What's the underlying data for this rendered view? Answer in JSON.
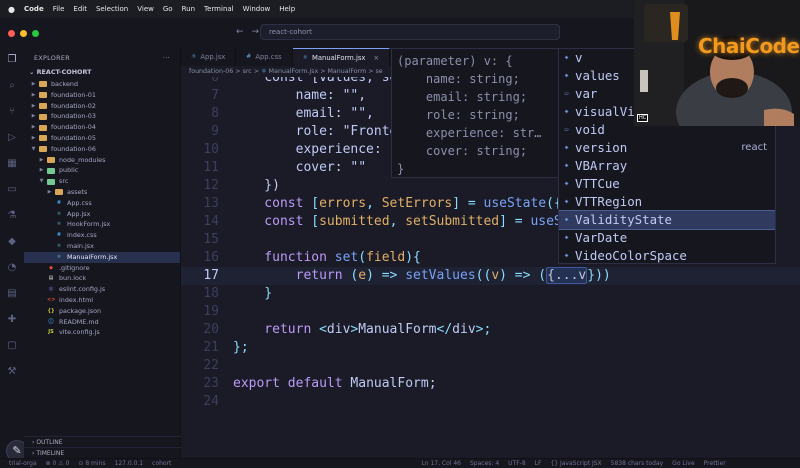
{
  "menubar": {
    "apple": "",
    "app_name": "Code",
    "items": [
      "File",
      "Edit",
      "Selection",
      "View",
      "Go",
      "Run",
      "Terminal",
      "Window",
      "Help"
    ]
  },
  "titlebar": {
    "command_center": "react-cohort"
  },
  "sidebar": {
    "title": "EXPLORER",
    "more": "···",
    "project": "REACT-COHORT",
    "tree": [
      {
        "label": "backend",
        "kind": "folder",
        "depth": 0,
        "open": false
      },
      {
        "label": "foundation-01",
        "kind": "folder",
        "depth": 0,
        "open": false
      },
      {
        "label": "foundation-02",
        "kind": "folder",
        "depth": 0,
        "open": false
      },
      {
        "label": "foundation-03",
        "kind": "folder",
        "depth": 0,
        "open": false
      },
      {
        "label": "foundation-04",
        "kind": "folder",
        "depth": 0,
        "open": false
      },
      {
        "label": "foundation-05",
        "kind": "folder",
        "depth": 0,
        "open": false
      },
      {
        "label": "foundation-06",
        "kind": "folder",
        "depth": 0,
        "open": true
      },
      {
        "label": "node_modules",
        "kind": "folder",
        "depth": 1,
        "open": false
      },
      {
        "label": "public",
        "kind": "folder-green",
        "depth": 1,
        "open": false
      },
      {
        "label": "src",
        "kind": "folder-green",
        "depth": 1,
        "open": true
      },
      {
        "label": "assets",
        "kind": "folder",
        "depth": 2,
        "open": false
      },
      {
        "label": "App.css",
        "kind": "css",
        "depth": 2
      },
      {
        "label": "App.jsx",
        "kind": "jsx",
        "depth": 2
      },
      {
        "label": "HookForm.jsx",
        "kind": "jsx",
        "depth": 2
      },
      {
        "label": "index.css",
        "kind": "css",
        "depth": 2
      },
      {
        "label": "main.jsx",
        "kind": "jsx",
        "depth": 2
      },
      {
        "label": "ManualForm.jsx",
        "kind": "jsx",
        "depth": 2,
        "selected": true
      },
      {
        "label": ".gitignore",
        "kind": "git",
        "depth": 1
      },
      {
        "label": "bun.lock",
        "kind": "lock",
        "depth": 1
      },
      {
        "label": "eslint.config.js",
        "kind": "eslint",
        "depth": 1
      },
      {
        "label": "index.html",
        "kind": "html",
        "depth": 1
      },
      {
        "label": "package.json",
        "kind": "json",
        "depth": 1
      },
      {
        "label": "README.md",
        "kind": "md",
        "depth": 1
      },
      {
        "label": "vite.config.js",
        "kind": "js",
        "depth": 1
      }
    ],
    "outline": "OUTLINE",
    "timeline": "TIMELINE"
  },
  "tabs": [
    {
      "label": "App.jsx",
      "icon": "react-icon",
      "active": false
    },
    {
      "label": "App.css",
      "icon": "css-icon",
      "active": false
    },
    {
      "label": "ManualForm.jsx",
      "icon": "react-icon",
      "active": true
    },
    {
      "label": "",
      "icon": "react-icon",
      "active": false
    }
  ],
  "breadcrumb": {
    "path": "foundation-06 > src > ",
    "file": "ManualForm.jsx",
    "sep": " > ",
    "symbol": "ManualForm",
    "tail": " > se"
  },
  "editor": {
    "lines": [
      {
        "n": "6",
        "tokens": [
          [
            "pl",
            "    "
          ],
          [
            "pl",
            "const [values, setValues] = useState({"
          ]
        ]
      },
      {
        "n": "7",
        "tokens": [
          [
            "pl",
            "        name: \"\","
          ]
        ]
      },
      {
        "n": "8",
        "tokens": [
          [
            "pl",
            "        email: \"\","
          ]
        ]
      },
      {
        "n": "9",
        "tokens": [
          [
            "pl",
            "        role: \"Frontend\","
          ]
        ]
      },
      {
        "n": "10",
        "tokens": [
          [
            "pl",
            "        experience: \"\","
          ]
        ]
      },
      {
        "n": "11",
        "tokens": [
          [
            "pl",
            "        cover: \"\""
          ]
        ]
      },
      {
        "n": "12",
        "tokens": [
          [
            "pl",
            "    })"
          ]
        ]
      },
      {
        "n": "13",
        "tokens": [
          [
            "kw",
            "    const "
          ],
          [
            "op",
            "["
          ],
          [
            "var",
            "errors"
          ],
          [
            "op",
            ", "
          ],
          [
            "var",
            "SetErrors"
          ],
          [
            "op",
            "] = "
          ],
          [
            "fn",
            "useState"
          ],
          [
            "op",
            "({})"
          ]
        ]
      },
      {
        "n": "14",
        "tokens": [
          [
            "kw",
            "    const "
          ],
          [
            "op",
            "["
          ],
          [
            "var",
            "submitted"
          ],
          [
            "op",
            ", "
          ],
          [
            "var",
            "setSubmitted"
          ],
          [
            "op",
            "] = "
          ],
          [
            "fn",
            "useState"
          ],
          [
            "op",
            "(false)"
          ]
        ]
      },
      {
        "n": "15",
        "tokens": [
          [
            "pl",
            ""
          ]
        ]
      },
      {
        "n": "16",
        "tokens": [
          [
            "kw",
            "    function "
          ],
          [
            "fn",
            "set"
          ],
          [
            "op",
            "("
          ],
          [
            "prm",
            "field"
          ],
          [
            "op",
            "){"
          ]
        ]
      },
      {
        "n": "17",
        "tokens": [
          [
            "kw",
            "        return "
          ],
          [
            "op",
            "("
          ],
          [
            "prm",
            "e"
          ],
          [
            "op",
            ") => "
          ],
          [
            "fn",
            "setValues"
          ],
          [
            "op",
            "(("
          ],
          [
            "prm",
            "v"
          ],
          [
            "op",
            ") => ("
          ],
          [
            "hl",
            "{...v"
          ],
          [
            "op",
            "})"
          ],
          [
            "op",
            ")"
          ]
        ],
        "current": true
      },
      {
        "n": "18",
        "tokens": [
          [
            "op",
            "    }"
          ]
        ]
      },
      {
        "n": "19",
        "tokens": [
          [
            "pl",
            ""
          ]
        ]
      },
      {
        "n": "20",
        "tokens": [
          [
            "kw",
            "    return "
          ],
          [
            "op",
            "<"
          ],
          [
            "pl",
            "div"
          ],
          [
            "op",
            ">"
          ],
          [
            "pl",
            "ManualForm"
          ],
          [
            "op",
            "</"
          ],
          [
            "pl",
            "div"
          ],
          [
            "op",
            ">;"
          ]
        ]
      },
      {
        "n": "21",
        "tokens": [
          [
            "op",
            "};"
          ]
        ]
      },
      {
        "n": "22",
        "tokens": [
          [
            "pl",
            ""
          ]
        ]
      },
      {
        "n": "23",
        "tokens": [
          [
            "kw",
            "export "
          ],
          [
            "kw",
            "default "
          ],
          [
            "pl",
            "ManualForm;"
          ]
        ]
      },
      {
        "n": "24",
        "tokens": [
          [
            "pl",
            ""
          ]
        ]
      }
    ]
  },
  "hover": {
    "lines": [
      "(parameter) v: {",
      "    name: string;",
      "    email: string;",
      "    role: string;",
      "    experience: str…",
      "    cover: string;",
      "}"
    ]
  },
  "suggest": {
    "items": [
      {
        "label": "v",
        "kind": "variable",
        "match": "v"
      },
      {
        "label": "values",
        "kind": "variable",
        "match": "v"
      },
      {
        "label": "var",
        "kind": "keyword",
        "match": "v"
      },
      {
        "label": "visualVie",
        "kind": "variable",
        "match": "v"
      },
      {
        "label": "void",
        "kind": "keyword",
        "match": "v"
      },
      {
        "label": "version",
        "kind": "variable",
        "match": "v",
        "detail": "react"
      },
      {
        "label": "VBArray",
        "kind": "variable",
        "match": "V"
      },
      {
        "label": "VTTCue",
        "kind": "variable",
        "match": "V"
      },
      {
        "label": "VTTRegion",
        "kind": "variable",
        "match": "V"
      },
      {
        "label": "ValidityState",
        "kind": "variable",
        "match": "V",
        "selected": true
      },
      {
        "label": "VarDate",
        "kind": "variable",
        "match": "V"
      },
      {
        "label": "VideoColorSpace",
        "kind": "variable",
        "match": "V"
      }
    ]
  },
  "webcam": {
    "brand": "ChaiCode",
    "badge": "HC"
  },
  "statusbar": {
    "items": [
      "trial-orga",
      "⊗ 0 ⚠ 0",
      "⊙ 8 mins",
      "127.0.0.1",
      "cohort",
      "Ln 17, Col 46",
      "Spaces: 4",
      "UTF-8",
      "LF",
      "{} JavaScript JSX",
      "5838 chars today",
      "Go Live",
      "Prettier"
    ]
  },
  "colors": {
    "accent": "#7aa2f7",
    "keyword": "#bb9af7",
    "string": "#9ece6a",
    "variable": "#e0af68",
    "background": "#1a1b26"
  }
}
